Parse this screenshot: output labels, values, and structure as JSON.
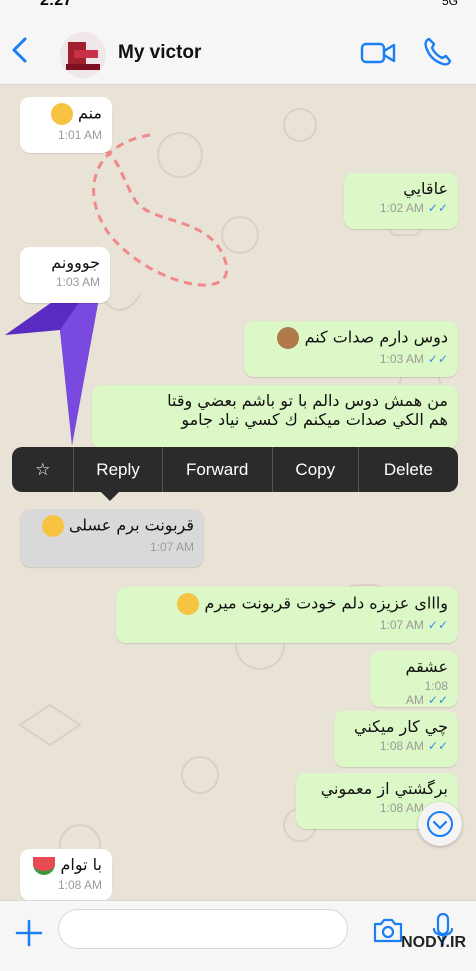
{
  "status": {
    "time": "2:27",
    "network": "5G"
  },
  "header": {
    "title": "My victor"
  },
  "messages": [
    {
      "text": "منم",
      "time": "1:01 AM"
    },
    {
      "text": "عاقايي",
      "time": "1:02 AM"
    },
    {
      "text": "جووونم",
      "time": "1:03 AM"
    },
    {
      "text": "دوس دارم صدات کنم",
      "time": "1:03 AM"
    },
    {
      "line1": "من همش دوس دالم با تو باشم بعضي وقتا",
      "line2": "هم الكي صدات ميكنم ك كسي نياد جامو"
    },
    {
      "text": "قربونت برم عسلی",
      "time": "1:07 AM"
    },
    {
      "text": "وااای عزيزه دلم خودت قربونت ميرم",
      "time": "1:07 AM"
    },
    {
      "text": "عشقم",
      "time": "1:08 AM"
    },
    {
      "text": "چي كار ميكني",
      "time": "1:08 AM"
    },
    {
      "text": "برگشتي از معموني",
      "time": "1:08 AM"
    },
    {
      "text": "با توام",
      "time": "1:08 AM"
    }
  ],
  "context_menu": {
    "star": "☆",
    "reply": "Reply",
    "forward": "Forward",
    "copy": "Copy",
    "delete": "Delete"
  },
  "watermark": {
    "main": "NODY.IR"
  },
  "colors": {
    "accent": "#1a7ef5",
    "outgoing": "#dcf8c6",
    "incoming": "#ffffff",
    "menu": "#2b2b2b"
  }
}
